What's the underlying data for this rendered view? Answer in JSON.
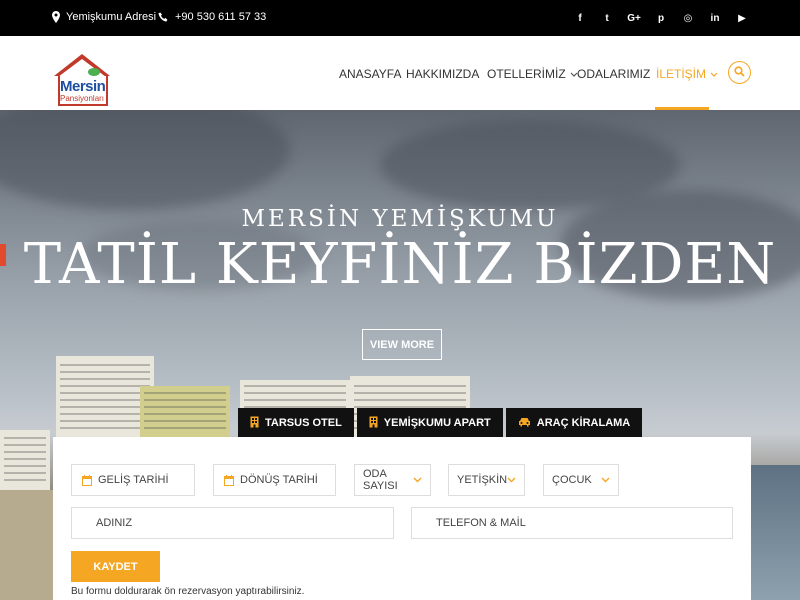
{
  "topbar": {
    "address": "Yemişkumu Adresi",
    "phone": "+90 530 611 57 33",
    "social": [
      {
        "icon": "facebook-icon",
        "glyph": "f"
      },
      {
        "icon": "twitter-icon",
        "glyph": "t"
      },
      {
        "icon": "google-plus-icon",
        "glyph": "G+"
      },
      {
        "icon": "pinterest-icon",
        "glyph": "p"
      },
      {
        "icon": "instagram-icon",
        "glyph": "◎"
      },
      {
        "icon": "linkedin-icon",
        "glyph": "in"
      },
      {
        "icon": "youtube-icon",
        "glyph": "▶"
      }
    ]
  },
  "logo": {
    "line1": "Mersin",
    "line2": "Pansiyonları"
  },
  "menu": [
    {
      "label": "ANASAYFA",
      "dropdown": false,
      "active": false
    },
    {
      "label": "HAKKIMIZDA",
      "dropdown": false,
      "active": false
    },
    {
      "label": "OTELLERİMİZ",
      "dropdown": true,
      "active": false
    },
    {
      "label": "ODALARIMIZ",
      "dropdown": false,
      "active": false
    },
    {
      "label": "İLETİŞİM",
      "dropdown": true,
      "active": true
    }
  ],
  "hero": {
    "subtitle": "MERSİN YEMİŞKUMU",
    "title": "TATİL KEYFİNİZ BİZDEN",
    "button": "VIEW MORE"
  },
  "tabs": [
    {
      "label": "TARSUS OTEL",
      "icon": "hotel-icon"
    },
    {
      "label": "YEMİŞKUMU APART",
      "icon": "building-icon"
    },
    {
      "label": "ARAÇ KİRALAMA",
      "icon": "car-icon"
    }
  ],
  "form": {
    "checkin": "GELİŞ TARİHİ",
    "checkout": "DÖNÜŞ TARİHİ",
    "rooms": "ODA SAYISI",
    "adults": "YETİŞKİN",
    "children": "ÇOCUK",
    "name": "ADINIZ",
    "contact": "TELEFON & MAİL",
    "submit": "KAYDET",
    "note": "Bu formu doldurarak ön rezervasyon yaptırabilirsiniz."
  },
  "colors": {
    "accent": "#f5a623",
    "topbar": "#000000",
    "tabs": "#111111"
  }
}
